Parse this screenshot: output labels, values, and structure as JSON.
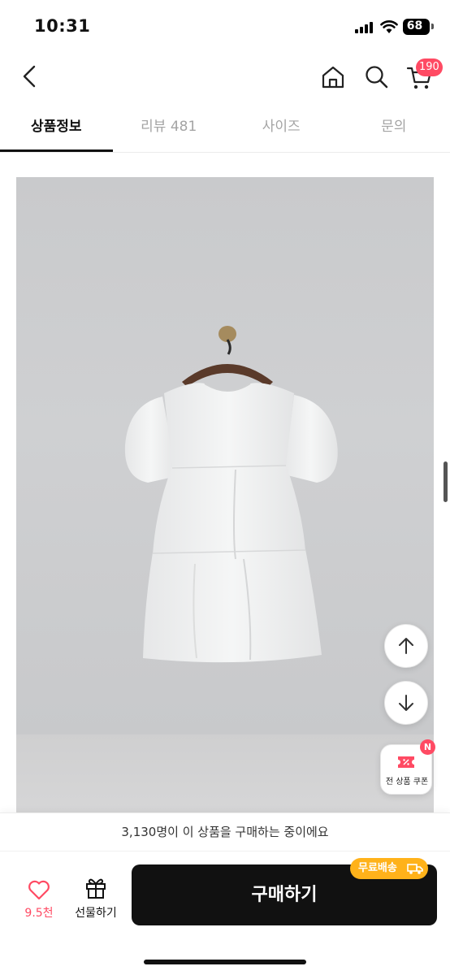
{
  "status_bar": {
    "time": "10:31",
    "battery": "68"
  },
  "header": {
    "cart_count": "190"
  },
  "tabs": [
    {
      "label": "상품정보",
      "active": true
    },
    {
      "label": "리뷰 481",
      "active": false
    },
    {
      "label": "사이즈",
      "active": false
    },
    {
      "label": "문의",
      "active": false
    }
  ],
  "floating": {
    "coupon_label": "전 상품 쿠폰",
    "coupon_new": "N"
  },
  "buyers_banner": "3,130명이 이 상품을 구매하는 중이에요",
  "bottom_bar": {
    "like_count": "9.5천",
    "gift_label": "선물하기",
    "buy_label": "구매하기",
    "shipping_badge": "무료배송"
  },
  "colors": {
    "accent": "#ff4a63",
    "buy_button": "#111111",
    "shipping_badge": "#ffb21a"
  },
  "icons": [
    "back-icon",
    "home-icon",
    "search-icon",
    "cart-icon",
    "arrow-up-icon",
    "arrow-down-icon",
    "coupon-icon",
    "heart-icon",
    "gift-icon",
    "truck-icon"
  ]
}
